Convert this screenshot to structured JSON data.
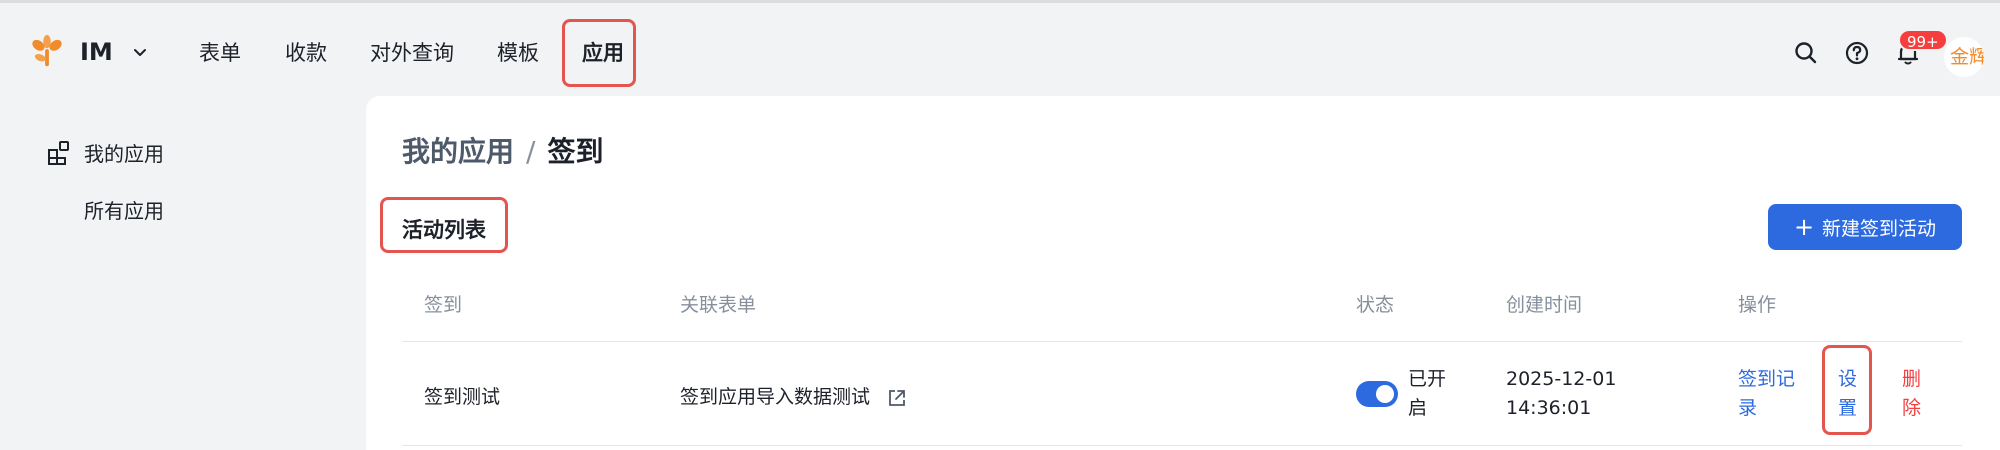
{
  "topbar": {
    "app_name": "IM",
    "nav": [
      "表单",
      "收款",
      "对外查询",
      "模板",
      "应用"
    ],
    "active_nav": "应用",
    "notification_badge": "99+",
    "avatar_text": "金辉"
  },
  "sidebar": {
    "items": [
      {
        "label": "我的应用",
        "icon": "apps-icon"
      },
      {
        "label": "所有应用"
      }
    ]
  },
  "main": {
    "breadcrumb": {
      "parent": "我的应用",
      "separator": "/",
      "current": "签到"
    },
    "section_title": "活动列表",
    "new_button": "新建签到活动",
    "table": {
      "headers": [
        "签到",
        "关联表单",
        "状态",
        "创建时间",
        "操作"
      ],
      "rows": [
        {
          "name": "签到测试",
          "form": "签到应用导入数据测试",
          "status_line1": "已开",
          "status_line2": "启",
          "status_on": true,
          "created_line1": "2025-12-01",
          "created_line2": "14:36:01",
          "action_records_line1": "签到记",
          "action_records_line2": "录",
          "action_settings_line1": "设",
          "action_settings_line2": "置",
          "action_delete_line1": "删",
          "action_delete_line2": "除"
        }
      ]
    }
  },
  "colors": {
    "primary": "#2d6ae0",
    "danger": "#f53f3f",
    "highlight": "#e5554f",
    "logo": "#f08c2c"
  }
}
